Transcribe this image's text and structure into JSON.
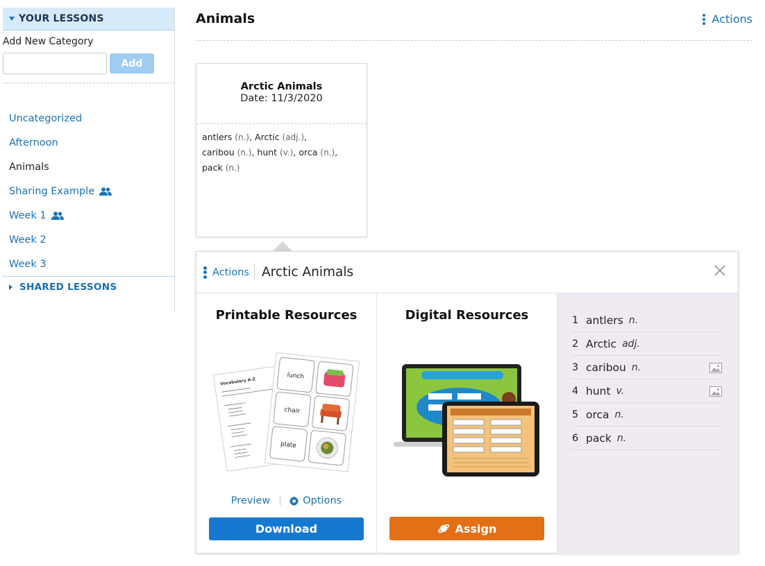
{
  "sidebar": {
    "your_lessons_label": "YOUR LESSONS",
    "add_category_label": "Add New Category",
    "add_input_value": "",
    "add_button_label": "Add",
    "categories": [
      {
        "label": "Uncategorized",
        "shared": false,
        "active": false
      },
      {
        "label": "Afternoon",
        "shared": false,
        "active": false
      },
      {
        "label": "Animals",
        "shared": false,
        "active": true
      },
      {
        "label": "Sharing Example",
        "shared": true,
        "active": false
      },
      {
        "label": "Week 1",
        "shared": true,
        "active": false
      },
      {
        "label": "Week 2",
        "shared": false,
        "active": false
      },
      {
        "label": "Week 3",
        "shared": false,
        "active": false
      }
    ],
    "shared_lessons_label": "SHARED LESSONS"
  },
  "main": {
    "title": "Animals",
    "actions_label": "Actions"
  },
  "lesson_card": {
    "title": "Arctic Animals",
    "date": "Date: 11/3/2020",
    "words": [
      {
        "word": "antlers",
        "pos": "(n.)"
      },
      {
        "word": "Arctic",
        "pos": "(adj.)"
      },
      {
        "word": "caribou",
        "pos": "(n.)"
      },
      {
        "word": "hunt",
        "pos": "(v.)"
      },
      {
        "word": "orca",
        "pos": "(n.)"
      },
      {
        "word": "pack",
        "pos": "(n.)"
      }
    ]
  },
  "panel": {
    "actions_label": "Actions",
    "title": "Arctic Animals",
    "printable": {
      "title": "Printable Resources",
      "preview_label": "Preview",
      "options_label": "Options",
      "download_label": "Download",
      "image_texts": {
        "sheet_title": "Vocabulary A-Z",
        "card_words": [
          "lunch",
          "chair",
          "plate"
        ]
      }
    },
    "digital": {
      "title": "Digital Resources",
      "assign_label": "Assign"
    },
    "vocab": [
      {
        "num": "1",
        "word": "antlers",
        "pos": "n.",
        "image": false
      },
      {
        "num": "2",
        "word": "Arctic",
        "pos": "adj.",
        "image": false
      },
      {
        "num": "3",
        "word": "caribou",
        "pos": "n.",
        "image": true
      },
      {
        "num": "4",
        "word": "hunt",
        "pos": "v.",
        "image": true
      },
      {
        "num": "5",
        "word": "orca",
        "pos": "n.",
        "image": false
      },
      {
        "num": "6",
        "word": "pack",
        "pos": "n.",
        "image": false
      }
    ]
  },
  "colors": {
    "link": "#1a72b7",
    "download": "#1679d0",
    "assign": "#e36f17",
    "vocab_bg": "#f1eaf3",
    "header_bg": "#d5ebfa"
  },
  "icons": {
    "caret_down": "caret-down-icon",
    "caret_right": "caret-right-icon",
    "people": "people-icon",
    "kebab": "kebab-icon",
    "close": "close-icon",
    "gear": "gear-icon",
    "planet": "planet-icon",
    "image": "image-icon"
  }
}
